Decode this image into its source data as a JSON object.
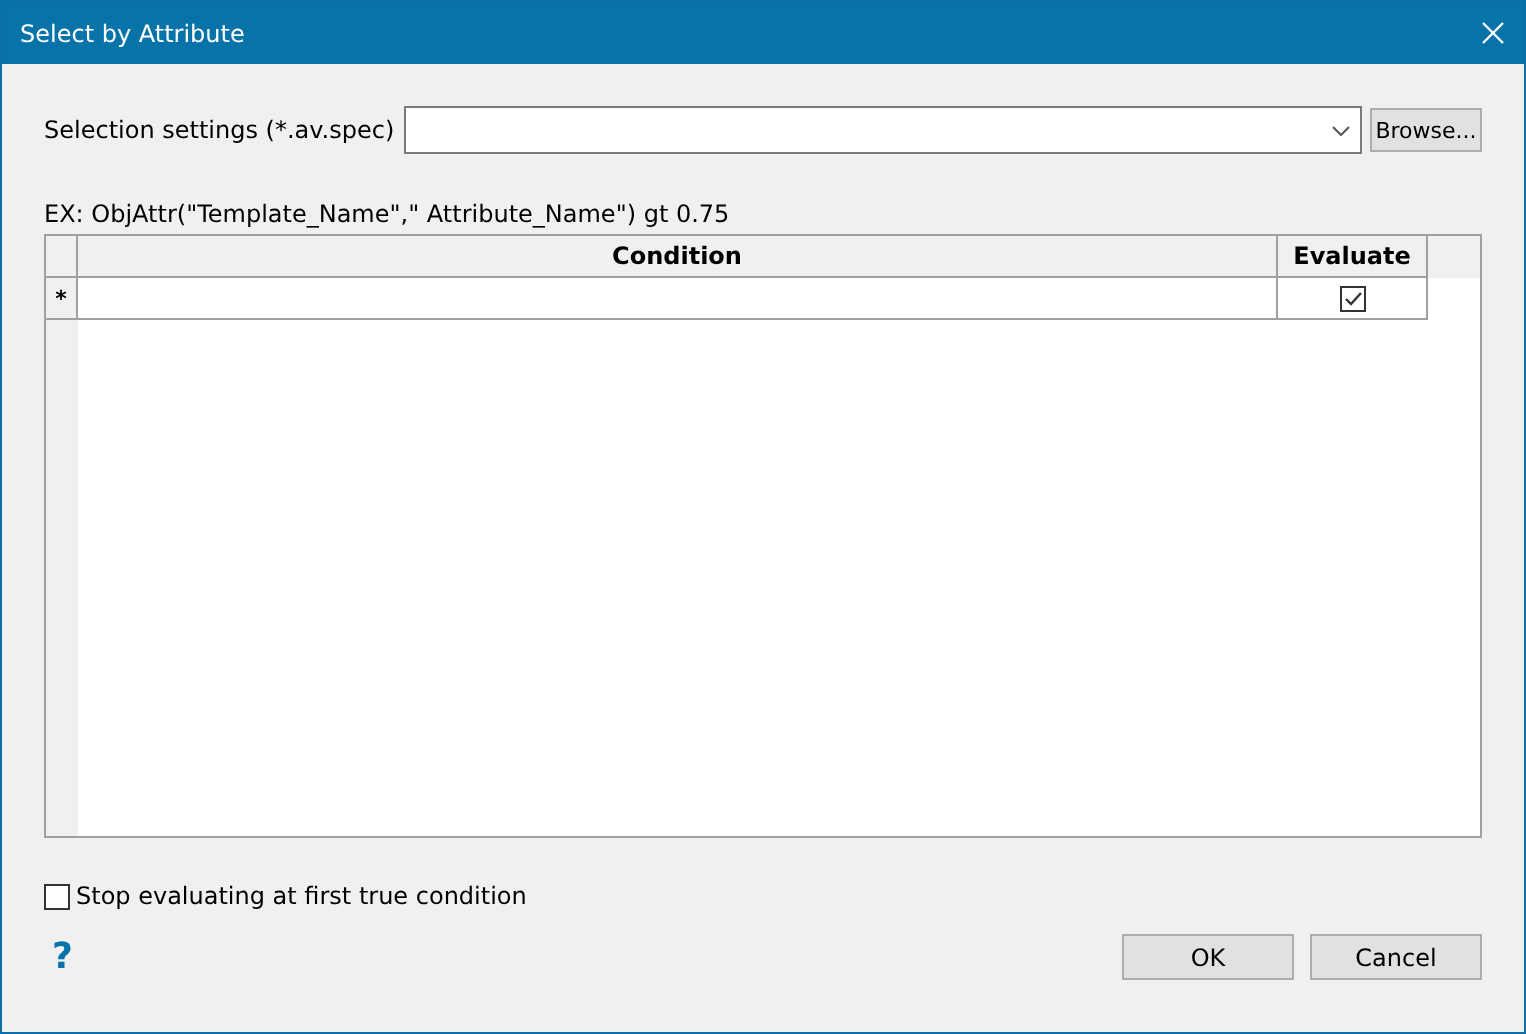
{
  "window": {
    "title": "Select by Attribute"
  },
  "selection_settings": {
    "label": "Selection settings (*.av.spec)",
    "browse_button": "Browse..."
  },
  "example": "EX: ObjAttr(\"Template_Name\",\" Attribute_Name\") gt 0.75",
  "table": {
    "columns": [
      "Condition",
      "Evaluate"
    ],
    "rows": [
      {
        "marker": "*",
        "evaluate": true
      }
    ]
  },
  "stop_option": {
    "label": "Stop evaluating at first true condition",
    "checked": false
  },
  "help": "?",
  "buttons": [
    "OK",
    "Cancel"
  ]
}
